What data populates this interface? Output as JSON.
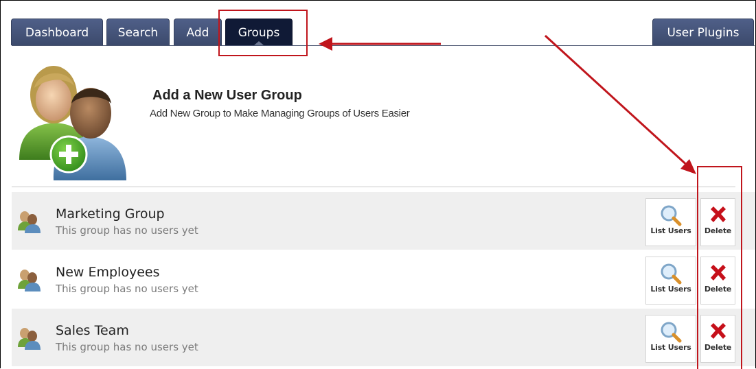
{
  "tabs": [
    {
      "label": "Dashboard"
    },
    {
      "label": "Search"
    },
    {
      "label": "Add"
    },
    {
      "label": "Groups",
      "active": true
    },
    {
      "label": "User Plugins"
    }
  ],
  "header": {
    "title": "Add a New User Group",
    "subtitle": "Add New Group to Make Managing Groups of Users Easier"
  },
  "groups": [
    {
      "name": "Marketing Group",
      "description": "This group has no users yet"
    },
    {
      "name": "New Employees",
      "description": "This group has no users yet"
    },
    {
      "name": "Sales Team",
      "description": "This group has no users yet"
    }
  ],
  "actions": {
    "list_users_label": "List Users",
    "delete_label": "Delete"
  },
  "colors": {
    "tab_bg": "#46557a",
    "tab_active_bg": "#101a36",
    "annotation_red": "#c0151c",
    "row_shaded": "#efefef"
  }
}
